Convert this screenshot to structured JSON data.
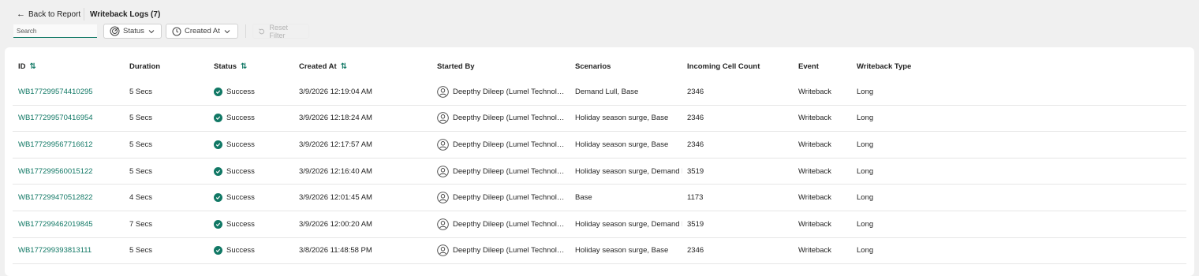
{
  "header": {
    "back_label": "Back to Report",
    "title": "Writeback Logs (7)"
  },
  "toolbar": {
    "search_placeholder": "Search",
    "status_filter_label": "Status",
    "created_filter_label": "Created At",
    "reset_label": "Reset Filter"
  },
  "table": {
    "columns": {
      "id": "ID",
      "duration": "Duration",
      "status": "Status",
      "created_at": "Created At",
      "started_by": "Started By",
      "scenarios": "Scenarios",
      "incoming_cell_count": "Incoming Cell Count",
      "event": "Event",
      "writeback_type": "Writeback Type"
    },
    "rows": [
      {
        "id": "WB177299574410295",
        "duration": "5 Secs",
        "status": "Success",
        "created_at": "3/9/2026 12:19:04 AM",
        "started_by": "Deepthy Dileep (Lumel Technolo...",
        "scenarios": "Demand Lull, Base",
        "count": "2346",
        "event": "Writeback",
        "type": "Long"
      },
      {
        "id": "WB177299570416954",
        "duration": "5 Secs",
        "status": "Success",
        "created_at": "3/9/2026 12:18:24 AM",
        "started_by": "Deepthy Dileep (Lumel Technolo...",
        "scenarios": "Holiday season surge, Base",
        "count": "2346",
        "event": "Writeback",
        "type": "Long"
      },
      {
        "id": "WB177299567716612",
        "duration": "5 Secs",
        "status": "Success",
        "created_at": "3/9/2026 12:17:57 AM",
        "started_by": "Deepthy Dileep (Lumel Technolo...",
        "scenarios": "Holiday season surge, Base",
        "count": "2346",
        "event": "Writeback",
        "type": "Long"
      },
      {
        "id": "WB177299560015122",
        "duration": "5 Secs",
        "status": "Success",
        "created_at": "3/9/2026 12:16:40 AM",
        "started_by": "Deepthy Dileep (Lumel Technolo...",
        "scenarios": "Holiday season surge, Demand L",
        "count": "3519",
        "event": "Writeback",
        "type": "Long"
      },
      {
        "id": "WB177299470512822",
        "duration": "4 Secs",
        "status": "Success",
        "created_at": "3/9/2026 12:01:45 AM",
        "started_by": "Deepthy Dileep (Lumel Technolo...",
        "scenarios": "Base",
        "count": "1173",
        "event": "Writeback",
        "type": "Long"
      },
      {
        "id": "WB177299462019845",
        "duration": "7 Secs",
        "status": "Success",
        "created_at": "3/9/2026 12:00:20 AM",
        "started_by": "Deepthy Dileep (Lumel Technolo...",
        "scenarios": "Holiday season surge, Demand L",
        "count": "3519",
        "event": "Writeback",
        "type": "Long"
      },
      {
        "id": "WB177299393813111",
        "duration": "5 Secs",
        "status": "Success",
        "created_at": "3/8/2026 11:48:58 PM",
        "started_by": "Deepthy Dileep (Lumel Technolo...",
        "scenarios": "Holiday season surge, Base",
        "count": "2346",
        "event": "Writeback",
        "type": "Long"
      }
    ]
  },
  "colors": {
    "accent": "#117865",
    "background": "#f0f0f0",
    "panel": "#ffffff"
  },
  "icons": {
    "back": "arrow-left-icon",
    "status_filter": "target-icon",
    "created_filter": "clock-icon",
    "dropdown": "chevron-down-icon",
    "reset": "reset-icon",
    "sort": "sort-icon",
    "status_success": "check-circle-icon",
    "user": "person-icon"
  }
}
